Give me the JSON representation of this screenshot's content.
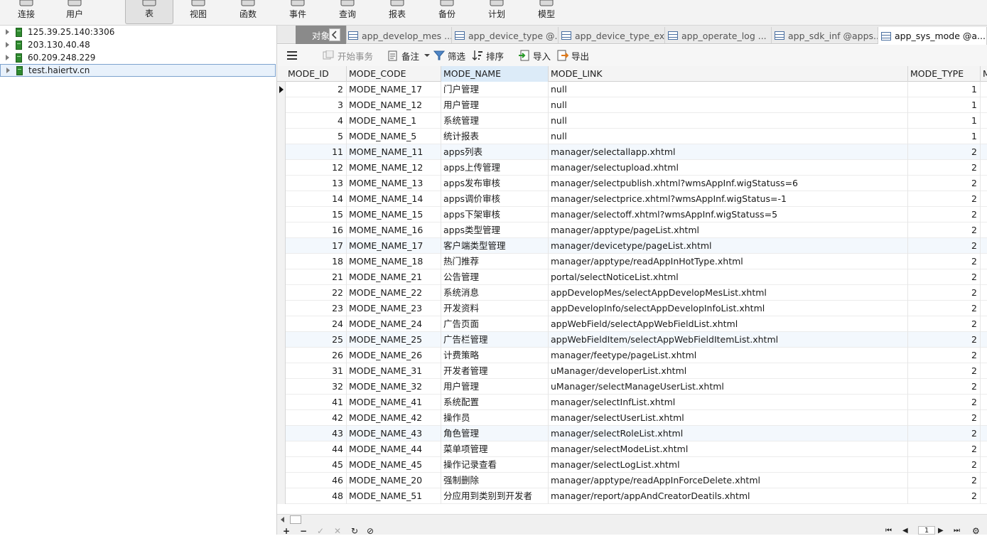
{
  "toolbar": {
    "buttons": [
      {
        "label": "连接",
        "icon": "connect-icon"
      },
      {
        "label": "用户",
        "icon": "user-icon"
      },
      {
        "label": "表",
        "icon": "table-icon",
        "active": true
      },
      {
        "label": "视图",
        "icon": "view-icon"
      },
      {
        "label": "函数",
        "icon": "function-icon"
      },
      {
        "label": "事件",
        "icon": "event-icon"
      },
      {
        "label": "查询",
        "icon": "query-icon"
      },
      {
        "label": "报表",
        "icon": "report-icon"
      },
      {
        "label": "备份",
        "icon": "backup-icon"
      },
      {
        "label": "计划",
        "icon": "schedule-icon"
      },
      {
        "label": "模型",
        "icon": "model-icon"
      }
    ]
  },
  "connections": [
    {
      "label": "125.39.25.140:3306"
    },
    {
      "label": "203.130.40.48"
    },
    {
      "label": "60.209.248.229"
    },
    {
      "label": "test.haiertv.cn",
      "selected": true
    }
  ],
  "tabs": {
    "objects_label": "对象",
    "items": [
      {
        "label": "app_develop_mes ..."
      },
      {
        "label": "app_device_type @..."
      },
      {
        "label": "app_device_type_ex..."
      },
      {
        "label": "app_operate_log ..."
      },
      {
        "label": "app_sdk_inf @apps..."
      },
      {
        "label": "app_sys_mode @a...",
        "active": true
      }
    ]
  },
  "grid_toolbar": {
    "menu_icon": "menu-icon",
    "begin_transaction": "开始事务",
    "memo": "备注",
    "filter": "筛选",
    "sort": "排序",
    "import": "导入",
    "export": "导出"
  },
  "table": {
    "columns": [
      "MODE_ID",
      "MODE_CODE",
      "MODE_NAME",
      "MODE_LINK",
      "MODE_TYPE",
      "M"
    ],
    "selected_column": "MODE_NAME",
    "rows": [
      {
        "id": "2",
        "code": "MODE_NAME_17",
        "name": "门户管理",
        "link": "null",
        "type": "1"
      },
      {
        "id": "3",
        "code": "MODE_NAME_12",
        "name": "用户管理",
        "link": "null",
        "type": "1"
      },
      {
        "id": "4",
        "code": "MODE_NAME_1",
        "name": "系统管理",
        "link": "null",
        "type": "1"
      },
      {
        "id": "5",
        "code": "MODE_NAME_5",
        "name": "统计报表",
        "link": "null",
        "type": "1"
      },
      {
        "id": "11",
        "code": "MOME_NAME_11",
        "name": "apps列表",
        "link": "manager/selectallapp.xhtml",
        "type": "2"
      },
      {
        "id": "12",
        "code": "MOME_NAME_12",
        "name": "apps上传管理",
        "link": "manager/selectupload.xhtml",
        "type": "2"
      },
      {
        "id": "13",
        "code": "MOME_NAME_13",
        "name": "apps发布审核",
        "link": "manager/selectpublish.xhtml?wmsAppInf.wigStatuss=6",
        "type": "2"
      },
      {
        "id": "14",
        "code": "MOME_NAME_14",
        "name": "apps调价审核",
        "link": "manager/selectprice.xhtml?wmsAppInf.wigStatus=-1",
        "type": "2"
      },
      {
        "id": "15",
        "code": "MOME_NAME_15",
        "name": "apps下架审核",
        "link": "manager/selectoff.xhtml?wmsAppInf.wigStatuss=5",
        "type": "2"
      },
      {
        "id": "16",
        "code": "MOME_NAME_16",
        "name": "apps类型管理",
        "link": "manager/apptype/pageList.xhtml",
        "type": "2"
      },
      {
        "id": "17",
        "code": "MOME_NAME_17",
        "name": "客户端类型管理",
        "link": "manager/devicetype/pageList.xhtml",
        "type": "2"
      },
      {
        "id": "18",
        "code": "MOME_NAME_18",
        "name": "热门推荐",
        "link": "manager/apptype/readAppInHotType.xhtml",
        "type": "2"
      },
      {
        "id": "21",
        "code": "MODE_NAME_21",
        "name": "公告管理",
        "link": "portal/selectNoticeList.xhtml",
        "type": "2"
      },
      {
        "id": "22",
        "code": "MODE_NAME_22",
        "name": "系统消息",
        "link": "appDevelopMes/selectAppDevelopMesList.xhtml",
        "type": "2"
      },
      {
        "id": "23",
        "code": "MODE_NAME_23",
        "name": "开发资料",
        "link": "appDevelopInfo/selectAppDevelopInfoList.xhtml",
        "type": "2"
      },
      {
        "id": "24",
        "code": "MODE_NAME_24",
        "name": "广告页面",
        "link": "appWebField/selectAppWebFieldList.xhtml",
        "type": "2"
      },
      {
        "id": "25",
        "code": "MODE_NAME_25",
        "name": "广告栏管理",
        "link": "appWebFieldItem/selectAppWebFieldItemList.xhtml",
        "type": "2"
      },
      {
        "id": "26",
        "code": "MODE_NAME_26",
        "name": "计费策略",
        "link": "manager/feetype/pageList.xhtml",
        "type": "2"
      },
      {
        "id": "31",
        "code": "MODE_NAME_31",
        "name": "开发者管理",
        "link": "uManager/developerList.xhtml",
        "type": "2"
      },
      {
        "id": "32",
        "code": "MODE_NAME_32",
        "name": "用户管理",
        "link": "uManager/selectManageUserList.xhtml",
        "type": "2"
      },
      {
        "id": "41",
        "code": "MODE_NAME_41",
        "name": "系统配置",
        "link": "manager/selectInfList.xhtml",
        "type": "2"
      },
      {
        "id": "42",
        "code": "MODE_NAME_42",
        "name": "操作员",
        "link": "manager/selectUserList.xhtml",
        "type": "2"
      },
      {
        "id": "43",
        "code": "MODE_NAME_43",
        "name": "角色管理",
        "link": "manager/selectRoleList.xhtml",
        "type": "2"
      },
      {
        "id": "44",
        "code": "MODE_NAME_44",
        "name": "菜单项管理",
        "link": "manager/selectModeList.xhtml",
        "type": "2"
      },
      {
        "id": "45",
        "code": "MODE_NAME_45",
        "name": "操作记录查看",
        "link": "manager/selectLogList.xhtml",
        "type": "2"
      },
      {
        "id": "46",
        "code": "MODE_NAME_20",
        "name": "强制删除",
        "link": "manager/apptype/readAppInForceDelete.xhtml",
        "type": "2"
      },
      {
        "id": "48",
        "code": "MODE_NAME_51",
        "name": "分应用到类别到开发者",
        "link": "manager/report/appAndCreatorDeatils.xhtml",
        "type": "2"
      }
    ]
  },
  "statusbar": {
    "page": "1",
    "add_symbol": "+",
    "remove_symbol": "−",
    "apply_symbol": "✓",
    "discard_symbol": "✕",
    "refresh_symbol": "↻",
    "stop_symbol": "⊘",
    "first_symbol": "⏮",
    "prev_symbol": "◀",
    "next_symbol": "▶",
    "last_symbol": "⏭",
    "settings_symbol": "⚙"
  }
}
